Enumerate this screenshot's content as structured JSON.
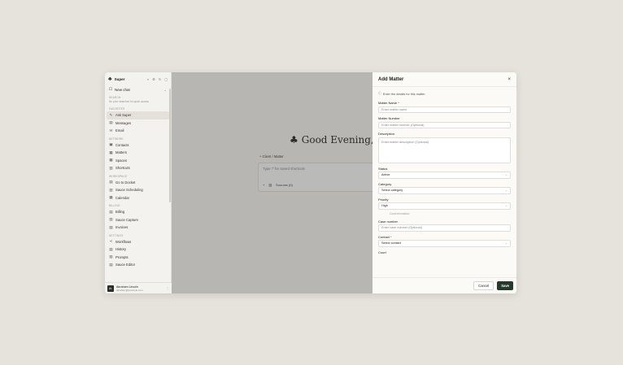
{
  "sidebar": {
    "app_name": "Super",
    "new_chat": "New chat",
    "section_search": "SEARCH",
    "search_hint": "No prior searches for quick access",
    "section_favorites": "FAVORITES",
    "favorites": [
      "Ask Super",
      "Messages",
      "Email"
    ],
    "section_network": "NETWORK",
    "network": [
      "Contacts",
      "Matters",
      "Spaces",
      "Shortcuts"
    ],
    "section_workspace": "WORKSPACE",
    "workspace": [
      "Go to Docket",
      "Sauce Scheduling",
      "Calendar"
    ],
    "section_billing": "BILLING",
    "billing": [
      "Billing",
      "Sauce Capture",
      "Invoices"
    ],
    "section_settings": "SETTINGS",
    "settings": [
      "Workflows",
      "History",
      "Prompts",
      "Sauce Editor"
    ],
    "user_name": "Abraham Lincoln",
    "user_email": "abraham@example.com",
    "user_initials": "AL"
  },
  "main": {
    "greeting": "Good Evening, A",
    "breadcrumb": "Client / Matter",
    "prompt_hint": "Type '/' for saved shortcuts",
    "prompt_tool": "Sources (0)"
  },
  "panel": {
    "title": "Add Matter",
    "info": "Enter the details for this matter.",
    "matter_name_label": "Matter Name",
    "matter_name_placeholder": "Enter matter name",
    "matter_number_label": "Matter Number",
    "matter_number_placeholder": "Enter matter number (Optional)",
    "description_label": "Description",
    "description_placeholder": "Enter matter description (Optional)",
    "status_label": "Status",
    "status_value": "Active",
    "category_label": "Category",
    "category_value": "Select category",
    "priority_label": "Priority",
    "priority_value": "High",
    "court_information": "Court information",
    "case_number_label": "Case number",
    "case_number_placeholder": "Enter case number (Optional)",
    "contact_label": "Contact",
    "contact_value": "Select contact",
    "court_label": "Court",
    "cancel": "Cancel",
    "save": "Save"
  }
}
